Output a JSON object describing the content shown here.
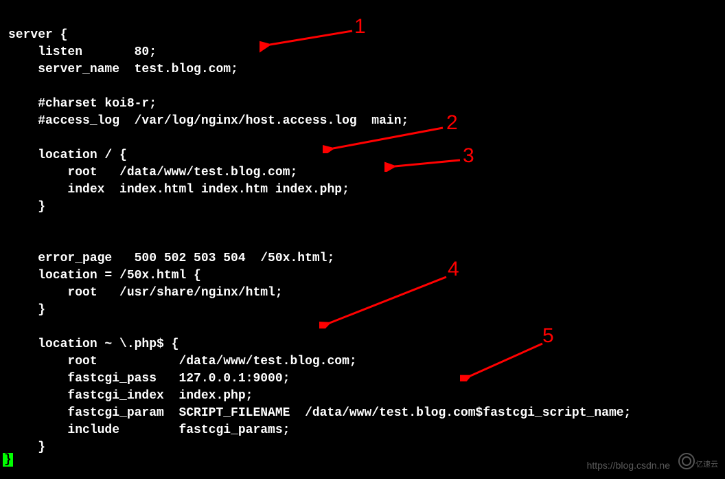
{
  "code": {
    "line1": "server {",
    "line2": "    listen       80;",
    "line3": "    server_name  test.blog.com;",
    "line4": "",
    "line5": "    #charset koi8-r;",
    "line6": "    #access_log  /var/log/nginx/host.access.log  main;",
    "line7": "",
    "line8": "    location / {",
    "line9": "        root   /data/www/test.blog.com;",
    "line10": "        index  index.html index.htm index.php;",
    "line11": "    }",
    "line12": "",
    "line13": "",
    "line14": "    error_page   500 502 503 504  /50x.html;",
    "line15": "    location = /50x.html {",
    "line16": "        root   /usr/share/nginx/html;",
    "line17": "    }",
    "line18": "",
    "line19": "    location ~ \\.php$ {",
    "line20": "        root           /data/www/test.blog.com;",
    "line21": "        fastcgi_pass   127.0.0.1:9000;",
    "line22": "        fastcgi_index  index.php;",
    "line23": "        fastcgi_param  SCRIPT_FILENAME  /data/www/test.blog.com$fastcgi_script_name;",
    "line24": "        include        fastcgi_params;",
    "line25": "    }",
    "closingBrace": "}"
  },
  "annotations": {
    "n1": "1",
    "n2": "2",
    "n3": "3",
    "n4": "4",
    "n5": "5"
  },
  "watermark": {
    "url": "https://blog.csdn.ne",
    "logoText": "亿速云"
  }
}
